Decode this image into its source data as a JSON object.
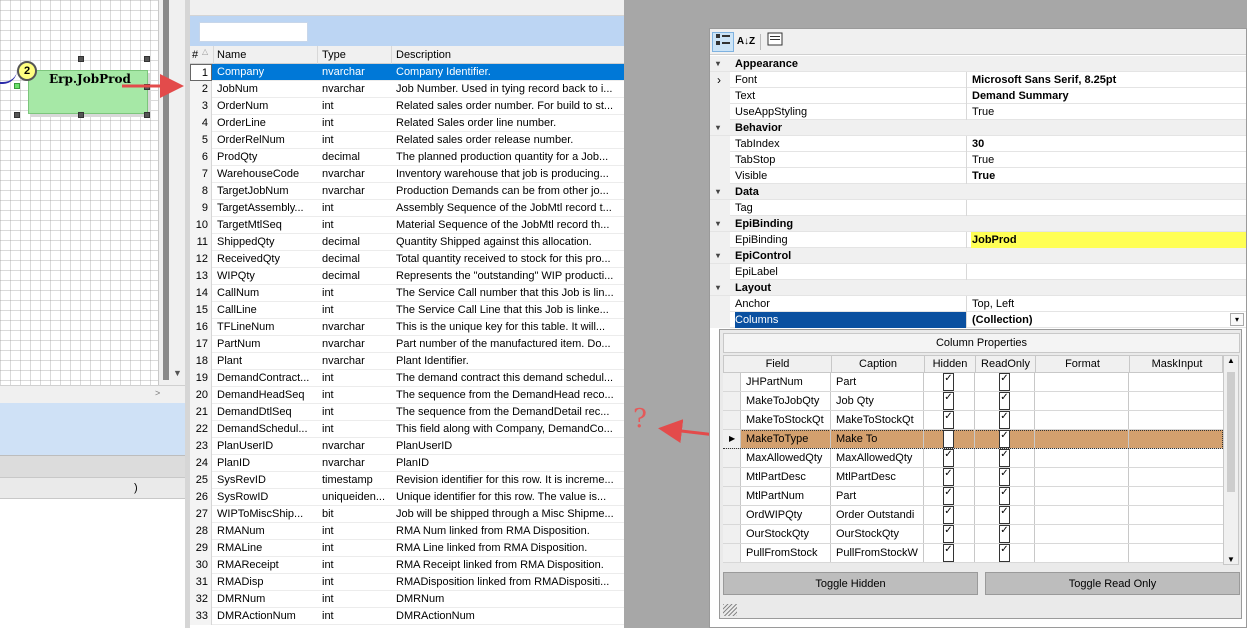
{
  "designer": {
    "node_label": "Erp.JobProd",
    "node_badge": "2",
    "hscroll_paren": ")"
  },
  "field_grid": {
    "headers": {
      "num": "#",
      "name": "Name",
      "type": "Type",
      "description": "Description"
    },
    "rows": [
      {
        "num": "1",
        "name": "Company",
        "type": "nvarchar",
        "desc": "Company Identifier."
      },
      {
        "num": "2",
        "name": "JobNum",
        "type": "nvarchar",
        "desc": "Job Number. Used in tying record back to i..."
      },
      {
        "num": "3",
        "name": "OrderNum",
        "type": "int",
        "desc": "Related sales order number. For build to st..."
      },
      {
        "num": "4",
        "name": "OrderLine",
        "type": "int",
        "desc": "Related Sales order line number."
      },
      {
        "num": "5",
        "name": "OrderRelNum",
        "type": "int",
        "desc": "Related sales order release number."
      },
      {
        "num": "6",
        "name": "ProdQty",
        "type": "decimal",
        "desc": "The planned production quantity for a Job..."
      },
      {
        "num": "7",
        "name": "WarehouseCode",
        "type": "nvarchar",
        "desc": "Inventory warehouse that job is producing..."
      },
      {
        "num": "8",
        "name": "TargetJobNum",
        "type": "nvarchar",
        "desc": "Production Demands can be from other jo..."
      },
      {
        "num": "9",
        "name": "TargetAssembly...",
        "type": "int",
        "desc": "Assembly Sequence of the JobMtl record t..."
      },
      {
        "num": "10",
        "name": "TargetMtlSeq",
        "type": "int",
        "desc": "Material Sequence of the JobMtl record th..."
      },
      {
        "num": "11",
        "name": "ShippedQty",
        "type": "decimal",
        "desc": "Quantity Shipped against this allocation."
      },
      {
        "num": "12",
        "name": "ReceivedQty",
        "type": "decimal",
        "desc": "Total quantity received to stock for this pro..."
      },
      {
        "num": "13",
        "name": "WIPQty",
        "type": "decimal",
        "desc": "Represents the \"outstanding\" WIP producti..."
      },
      {
        "num": "14",
        "name": "CallNum",
        "type": "int",
        "desc": "The Service Call number that this Job is lin..."
      },
      {
        "num": "15",
        "name": "CallLine",
        "type": "int",
        "desc": "The Service Call Line that this Job is linke..."
      },
      {
        "num": "16",
        "name": "TFLineNum",
        "type": "nvarchar",
        "desc": "This is the unique key for this table.  It will..."
      },
      {
        "num": "17",
        "name": "PartNum",
        "type": "nvarchar",
        "desc": "Part number of the manufactured item.  Do..."
      },
      {
        "num": "18",
        "name": "Plant",
        "type": "nvarchar",
        "desc": "Plant Identifier."
      },
      {
        "num": "19",
        "name": "DemandContract...",
        "type": "int",
        "desc": "The demand contract this demand schedul..."
      },
      {
        "num": "20",
        "name": "DemandHeadSeq",
        "type": "int",
        "desc": "The sequence from the DemandHead reco..."
      },
      {
        "num": "21",
        "name": "DemandDtlSeq",
        "type": "int",
        "desc": "The sequence from the DemandDetail rec..."
      },
      {
        "num": "22",
        "name": "DemandSchedul...",
        "type": "int",
        "desc": "This field along with Company, DemandCo..."
      },
      {
        "num": "23",
        "name": "PlanUserID",
        "type": "nvarchar",
        "desc": "PlanUserID"
      },
      {
        "num": "24",
        "name": "PlanID",
        "type": "nvarchar",
        "desc": "PlanID"
      },
      {
        "num": "25",
        "name": "SysRevID",
        "type": "timestamp",
        "desc": "Revision identifier for this row. It is increme..."
      },
      {
        "num": "26",
        "name": "SysRowID",
        "type": "uniqueiden...",
        "desc": "Unique identifier for this row. The value is..."
      },
      {
        "num": "27",
        "name": "WIPToMiscShip...",
        "type": "bit",
        "desc": "Job will be shipped through a Misc Shipme..."
      },
      {
        "num": "28",
        "name": "RMANum",
        "type": "int",
        "desc": "RMA Num linked from RMA Disposition."
      },
      {
        "num": "29",
        "name": "RMALine",
        "type": "int",
        "desc": "RMA Line linked from RMA Disposition."
      },
      {
        "num": "30",
        "name": "RMAReceipt",
        "type": "int",
        "desc": "RMA Receipt linked from RMA Disposition."
      },
      {
        "num": "31",
        "name": "RMADisp",
        "type": "int",
        "desc": "RMADisposition linked from RMADispositi..."
      },
      {
        "num": "32",
        "name": "DMRNum",
        "type": "int",
        "desc": "DMRNum"
      },
      {
        "num": "33",
        "name": "DMRActionNum",
        "type": "int",
        "desc": "DMRActionNum"
      }
    ],
    "selected_row": "1"
  },
  "properties": {
    "toolbar": {
      "categorized_icon": "categorized-icon",
      "alpha_label": "A↓Z",
      "pages_icon": "property-pages-icon"
    },
    "rows": [
      {
        "kind": "cat",
        "label": "Appearance"
      },
      {
        "kind": "prop",
        "name": "Font",
        "value": "Microsoft Sans Serif, 8.25pt",
        "bold": true,
        "expander": true
      },
      {
        "kind": "prop",
        "name": "Text",
        "value": "Demand Summary",
        "bold": true
      },
      {
        "kind": "prop",
        "name": "UseAppStyling",
        "value": "True"
      },
      {
        "kind": "cat",
        "label": "Behavior"
      },
      {
        "kind": "prop",
        "name": "TabIndex",
        "value": "30",
        "bold": true
      },
      {
        "kind": "prop",
        "name": "TabStop",
        "value": "True"
      },
      {
        "kind": "prop",
        "name": "Visible",
        "value": "True",
        "bold": true
      },
      {
        "kind": "cat",
        "label": "Data"
      },
      {
        "kind": "prop",
        "name": "Tag",
        "value": ""
      },
      {
        "kind": "cat",
        "label": "EpiBinding"
      },
      {
        "kind": "prop",
        "name": "EpiBinding",
        "value": "JobProd",
        "bold": true,
        "yellow": true
      },
      {
        "kind": "cat",
        "label": "EpiControl"
      },
      {
        "kind": "prop",
        "name": "EpiLabel",
        "value": ""
      },
      {
        "kind": "cat",
        "label": "Layout"
      },
      {
        "kind": "prop",
        "name": "Anchor",
        "value": "Top, Left"
      },
      {
        "kind": "prop",
        "name": "Columns",
        "value": "(Collection)",
        "bold": true,
        "selected": true,
        "dropdown": true
      }
    ]
  },
  "column_properties": {
    "title": "Column Properties",
    "headers": [
      "Field",
      "Caption",
      "Hidden",
      "ReadOnly",
      "Format",
      "MaskInput"
    ],
    "rows": [
      {
        "field": "JHPartNum",
        "caption": "Part",
        "hidden": true,
        "readonly": true
      },
      {
        "field": "MakeToJobQty",
        "caption": "Job Qty",
        "hidden": true,
        "readonly": true
      },
      {
        "field": "MakeToStockQt",
        "caption": "MakeToStockQt",
        "hidden": true,
        "readonly": true
      },
      {
        "field": "MakeToType",
        "caption": "Make To",
        "hidden": false,
        "readonly": true,
        "highlight": true
      },
      {
        "field": "MaxAllowedQty",
        "caption": "MaxAllowedQty",
        "hidden": true,
        "readonly": true
      },
      {
        "field": "MtlPartDesc",
        "caption": "MtlPartDesc",
        "hidden": true,
        "readonly": true
      },
      {
        "field": "MtlPartNum",
        "caption": "Part",
        "hidden": true,
        "readonly": true
      },
      {
        "field": "OrdWIPQty",
        "caption": "Order Outstandi",
        "hidden": true,
        "readonly": true
      },
      {
        "field": "OurStockQty",
        "caption": "OurStockQty",
        "hidden": true,
        "readonly": true
      },
      {
        "field": "PullFromStock",
        "caption": "PullFromStockW",
        "hidden": true,
        "readonly": true
      }
    ],
    "toggle_hidden_label": "Toggle Hidden",
    "toggle_readonly_label": "Toggle Read Only"
  },
  "annotation": {
    "question_mark": "?",
    "arrow_color": "#e34b4b"
  }
}
